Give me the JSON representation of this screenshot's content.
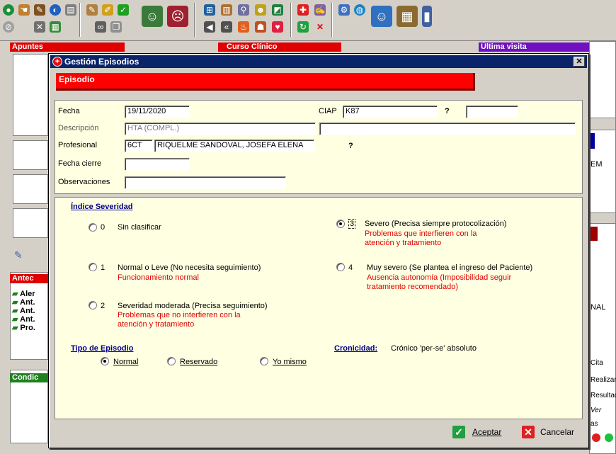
{
  "toolbar": {
    "icons": [
      "world-icon",
      "hand-icon",
      "pen-icon",
      "globe-icon",
      "document-icon",
      "tools-icon",
      "building-icon",
      "pencil-icon",
      "paint-icon",
      "checklist-icon",
      "users-icon",
      "user-remove-icon",
      "network-icon",
      "book-icon",
      "search-icon",
      "family-icon",
      "chart-icon",
      "hospital-icon",
      "write-icon",
      "settings-icon",
      "users-large-icon",
      "archive-icon"
    ]
  },
  "background": {
    "apuntes": "Apuntes",
    "curso_clinico": "Curso Clínico",
    "ultima_visita": "Última visita",
    "antec": "Antec",
    "antec_items": [
      "Aler",
      "Ant.",
      "Ant.",
      "Ant.",
      "Pro."
    ],
    "condic": "Condic",
    "right_em": "EM",
    "right_nal": "NAL",
    "right_cita": "Cita",
    "right_realizar": "Realizar",
    "right_resultado": "Resultad",
    "right_ver": "Ver",
    "right_as": "as"
  },
  "dialog": {
    "title": "Gestión Episodios",
    "close_label": "✕",
    "section": "Episodio",
    "fecha_label": "Fecha",
    "fecha_value": "19/11/2020",
    "ciap_label": "CIAP",
    "ciap_value": "K87",
    "ciap_q": "?",
    "ciap_extra_value": "",
    "descripcion_label": "Descripción",
    "descripcion_value": "HTA (COMPL.)",
    "descripcion_extra": "",
    "profesional_label": "Profesional",
    "profesional_code": "6CT",
    "profesional_name": "RIQUELME SANDOVAL, JOSEFA ELENA",
    "profesional_q": "?",
    "fecha_cierre_label": "Fecha cierre",
    "fecha_cierre_value": "",
    "observaciones_label": "Observaciones",
    "observaciones_value": "",
    "severidad_title": "Índice Severidad",
    "severity": [
      {
        "num": "0",
        "label": "Sin clasificar",
        "desc": "",
        "checked": false
      },
      {
        "num": "1",
        "label": "Normal o Leve (No necesita seguimiento)",
        "desc": "Funcionamiento normal",
        "checked": false
      },
      {
        "num": "2",
        "label": "Severidad moderada (Precisa seguimiento)",
        "desc": "Problemas que no interfieren con la",
        "desc2": "atención y tratamiento",
        "checked": false
      },
      {
        "num": "3",
        "label": "Severo (Precisa siempre protocolización)",
        "desc": "Problemas que interfieren con la",
        "desc2": "atención y tratamiento",
        "checked": true
      },
      {
        "num": "4",
        "label": "Muy severo (Se plantea el ingreso del Paciente)",
        "desc": "Ausencia autonomía (Imposibilidad seguir",
        "desc2": "tratamiento recomendado)",
        "checked": false
      }
    ],
    "tipo_title": "Tipo de Episodio",
    "tipo_options": [
      "Normal",
      "Reservado",
      "Yo mismo"
    ],
    "tipo_selected": "Normal",
    "cronicidad_label": "Cronicidad:",
    "cronicidad_value": "Crónico 'per-se' absoluto",
    "aceptar": "Aceptar",
    "cancelar": "Cancelar",
    "accent_red": "#ff0000",
    "title_blue": "#0a246a"
  }
}
